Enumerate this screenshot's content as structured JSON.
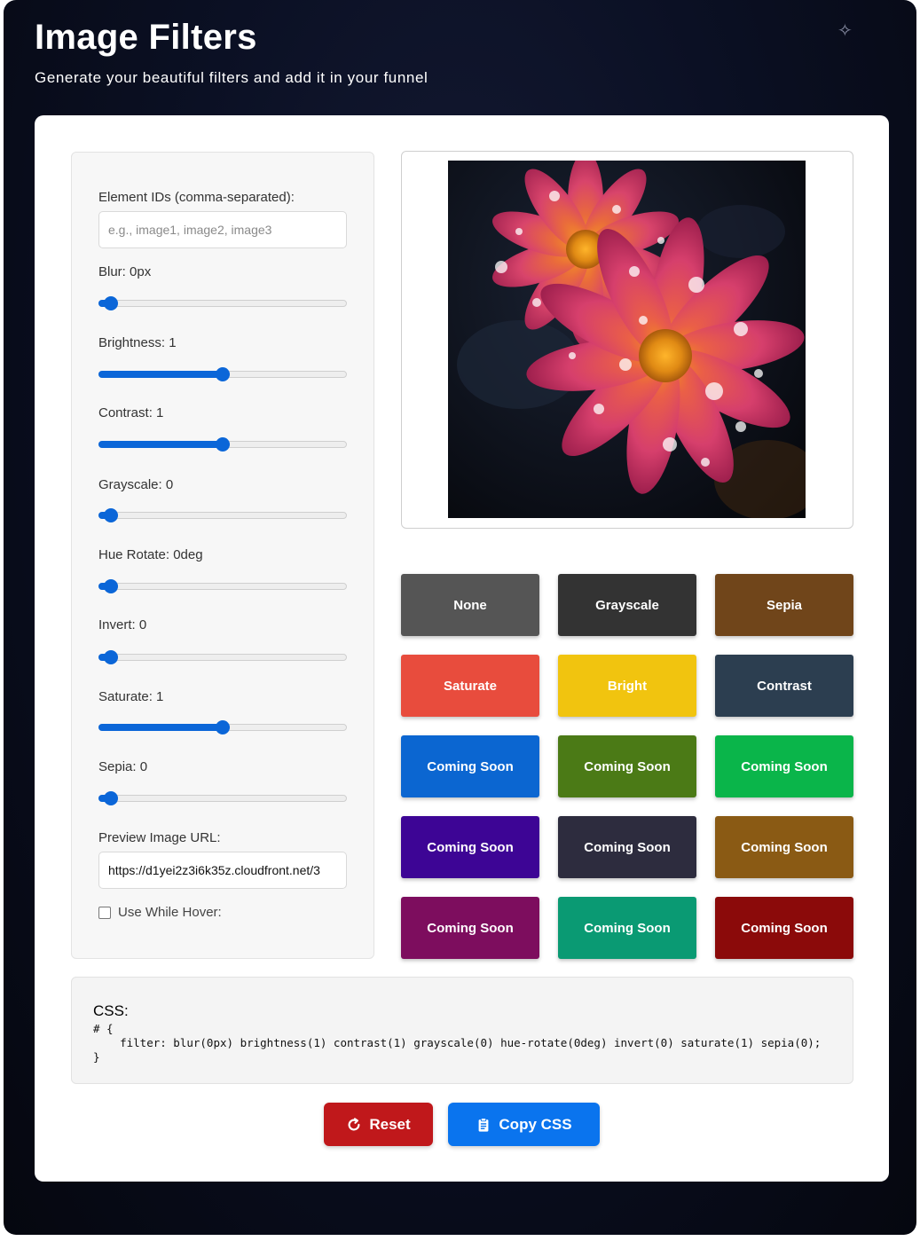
{
  "header": {
    "title": "Image Filters",
    "subtitle": "Generate your beautiful filters and add it in your funnel"
  },
  "controls": {
    "element_ids_label": "Element IDs (comma-separated):",
    "element_ids_placeholder": "e.g., image1, image2, image3",
    "sliders": [
      {
        "label": "Blur: 0px",
        "value": 0
      },
      {
        "label": "Brightness: 1",
        "value": 0.5
      },
      {
        "label": "Contrast: 1",
        "value": 0.5
      },
      {
        "label": "Grayscale: 0",
        "value": 0
      },
      {
        "label": "Hue Rotate: 0deg",
        "value": 0
      },
      {
        "label": "Invert: 0",
        "value": 0
      },
      {
        "label": "Saturate: 1",
        "value": 0.5
      },
      {
        "label": "Sepia: 0",
        "value": 0
      }
    ],
    "preview_url_label": "Preview Image URL:",
    "preview_url_value": "https://d1yei2z3i6k35z.cloudfront.net/3",
    "hover_label": "Use While Hover:",
    "hover_checked": false
  },
  "presets": [
    {
      "label": "None",
      "color": "#555555"
    },
    {
      "label": "Grayscale",
      "color": "#333333"
    },
    {
      "label": "Sepia",
      "color": "#70451a"
    },
    {
      "label": "Saturate",
      "color": "#e84c3d"
    },
    {
      "label": "Bright",
      "color": "#f1c40f"
    },
    {
      "label": "Contrast",
      "color": "#2c3e50"
    },
    {
      "label": "Coming Soon",
      "color": "#0b66d1"
    },
    {
      "label": "Coming Soon",
      "color": "#4b7a16"
    },
    {
      "label": "Coming Soon",
      "color": "#0ab54a"
    },
    {
      "label": "Coming Soon",
      "color": "#3d0595"
    },
    {
      "label": "Coming Soon",
      "color": "#2d2c3e"
    },
    {
      "label": "Coming Soon",
      "color": "#8a5a14"
    },
    {
      "label": "Coming Soon",
      "color": "#7d0d5e"
    },
    {
      "label": "Coming Soon",
      "color": "#0a9a73"
    },
    {
      "label": "Coming Soon",
      "color": "#8b0a0a"
    }
  ],
  "css_output": {
    "title": "CSS:",
    "code": "# {\n    filter: blur(0px) brightness(1) contrast(1) grayscale(0) hue-rotate(0deg) invert(0) saturate(1) sepia(0);\n}"
  },
  "actions": {
    "reset_label": "Reset",
    "copy_label": "Copy CSS",
    "reset_color": "#c0181b",
    "copy_color": "#0a74ee"
  }
}
